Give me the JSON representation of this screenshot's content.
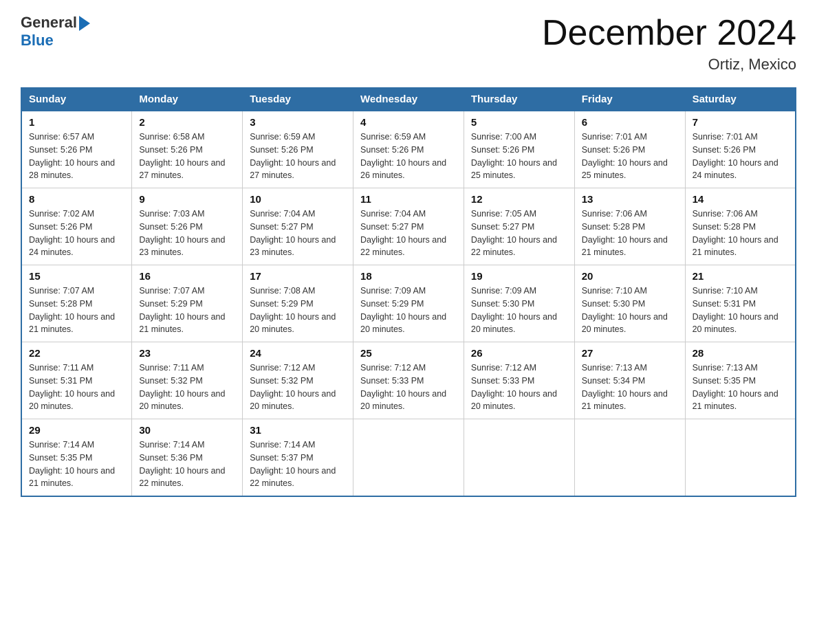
{
  "header": {
    "logo_general": "General",
    "logo_blue": "Blue",
    "month_title": "December 2024",
    "location": "Ortiz, Mexico"
  },
  "days_of_week": [
    "Sunday",
    "Monday",
    "Tuesday",
    "Wednesday",
    "Thursday",
    "Friday",
    "Saturday"
  ],
  "weeks": [
    [
      {
        "day": "1",
        "sunrise": "6:57 AM",
        "sunset": "5:26 PM",
        "daylight": "10 hours and 28 minutes."
      },
      {
        "day": "2",
        "sunrise": "6:58 AM",
        "sunset": "5:26 PM",
        "daylight": "10 hours and 27 minutes."
      },
      {
        "day": "3",
        "sunrise": "6:59 AM",
        "sunset": "5:26 PM",
        "daylight": "10 hours and 27 minutes."
      },
      {
        "day": "4",
        "sunrise": "6:59 AM",
        "sunset": "5:26 PM",
        "daylight": "10 hours and 26 minutes."
      },
      {
        "day": "5",
        "sunrise": "7:00 AM",
        "sunset": "5:26 PM",
        "daylight": "10 hours and 25 minutes."
      },
      {
        "day": "6",
        "sunrise": "7:01 AM",
        "sunset": "5:26 PM",
        "daylight": "10 hours and 25 minutes."
      },
      {
        "day": "7",
        "sunrise": "7:01 AM",
        "sunset": "5:26 PM",
        "daylight": "10 hours and 24 minutes."
      }
    ],
    [
      {
        "day": "8",
        "sunrise": "7:02 AM",
        "sunset": "5:26 PM",
        "daylight": "10 hours and 24 minutes."
      },
      {
        "day": "9",
        "sunrise": "7:03 AM",
        "sunset": "5:26 PM",
        "daylight": "10 hours and 23 minutes."
      },
      {
        "day": "10",
        "sunrise": "7:04 AM",
        "sunset": "5:27 PM",
        "daylight": "10 hours and 23 minutes."
      },
      {
        "day": "11",
        "sunrise": "7:04 AM",
        "sunset": "5:27 PM",
        "daylight": "10 hours and 22 minutes."
      },
      {
        "day": "12",
        "sunrise": "7:05 AM",
        "sunset": "5:27 PM",
        "daylight": "10 hours and 22 minutes."
      },
      {
        "day": "13",
        "sunrise": "7:06 AM",
        "sunset": "5:28 PM",
        "daylight": "10 hours and 21 minutes."
      },
      {
        "day": "14",
        "sunrise": "7:06 AM",
        "sunset": "5:28 PM",
        "daylight": "10 hours and 21 minutes."
      }
    ],
    [
      {
        "day": "15",
        "sunrise": "7:07 AM",
        "sunset": "5:28 PM",
        "daylight": "10 hours and 21 minutes."
      },
      {
        "day": "16",
        "sunrise": "7:07 AM",
        "sunset": "5:29 PM",
        "daylight": "10 hours and 21 minutes."
      },
      {
        "day": "17",
        "sunrise": "7:08 AM",
        "sunset": "5:29 PM",
        "daylight": "10 hours and 20 minutes."
      },
      {
        "day": "18",
        "sunrise": "7:09 AM",
        "sunset": "5:29 PM",
        "daylight": "10 hours and 20 minutes."
      },
      {
        "day": "19",
        "sunrise": "7:09 AM",
        "sunset": "5:30 PM",
        "daylight": "10 hours and 20 minutes."
      },
      {
        "day": "20",
        "sunrise": "7:10 AM",
        "sunset": "5:30 PM",
        "daylight": "10 hours and 20 minutes."
      },
      {
        "day": "21",
        "sunrise": "7:10 AM",
        "sunset": "5:31 PM",
        "daylight": "10 hours and 20 minutes."
      }
    ],
    [
      {
        "day": "22",
        "sunrise": "7:11 AM",
        "sunset": "5:31 PM",
        "daylight": "10 hours and 20 minutes."
      },
      {
        "day": "23",
        "sunrise": "7:11 AM",
        "sunset": "5:32 PM",
        "daylight": "10 hours and 20 minutes."
      },
      {
        "day": "24",
        "sunrise": "7:12 AM",
        "sunset": "5:32 PM",
        "daylight": "10 hours and 20 minutes."
      },
      {
        "day": "25",
        "sunrise": "7:12 AM",
        "sunset": "5:33 PM",
        "daylight": "10 hours and 20 minutes."
      },
      {
        "day": "26",
        "sunrise": "7:12 AM",
        "sunset": "5:33 PM",
        "daylight": "10 hours and 20 minutes."
      },
      {
        "day": "27",
        "sunrise": "7:13 AM",
        "sunset": "5:34 PM",
        "daylight": "10 hours and 21 minutes."
      },
      {
        "day": "28",
        "sunrise": "7:13 AM",
        "sunset": "5:35 PM",
        "daylight": "10 hours and 21 minutes."
      }
    ],
    [
      {
        "day": "29",
        "sunrise": "7:14 AM",
        "sunset": "5:35 PM",
        "daylight": "10 hours and 21 minutes."
      },
      {
        "day": "30",
        "sunrise": "7:14 AM",
        "sunset": "5:36 PM",
        "daylight": "10 hours and 22 minutes."
      },
      {
        "day": "31",
        "sunrise": "7:14 AM",
        "sunset": "5:37 PM",
        "daylight": "10 hours and 22 minutes."
      },
      null,
      null,
      null,
      null
    ]
  ],
  "labels": {
    "sunrise": "Sunrise:",
    "sunset": "Sunset:",
    "daylight": "Daylight:"
  }
}
